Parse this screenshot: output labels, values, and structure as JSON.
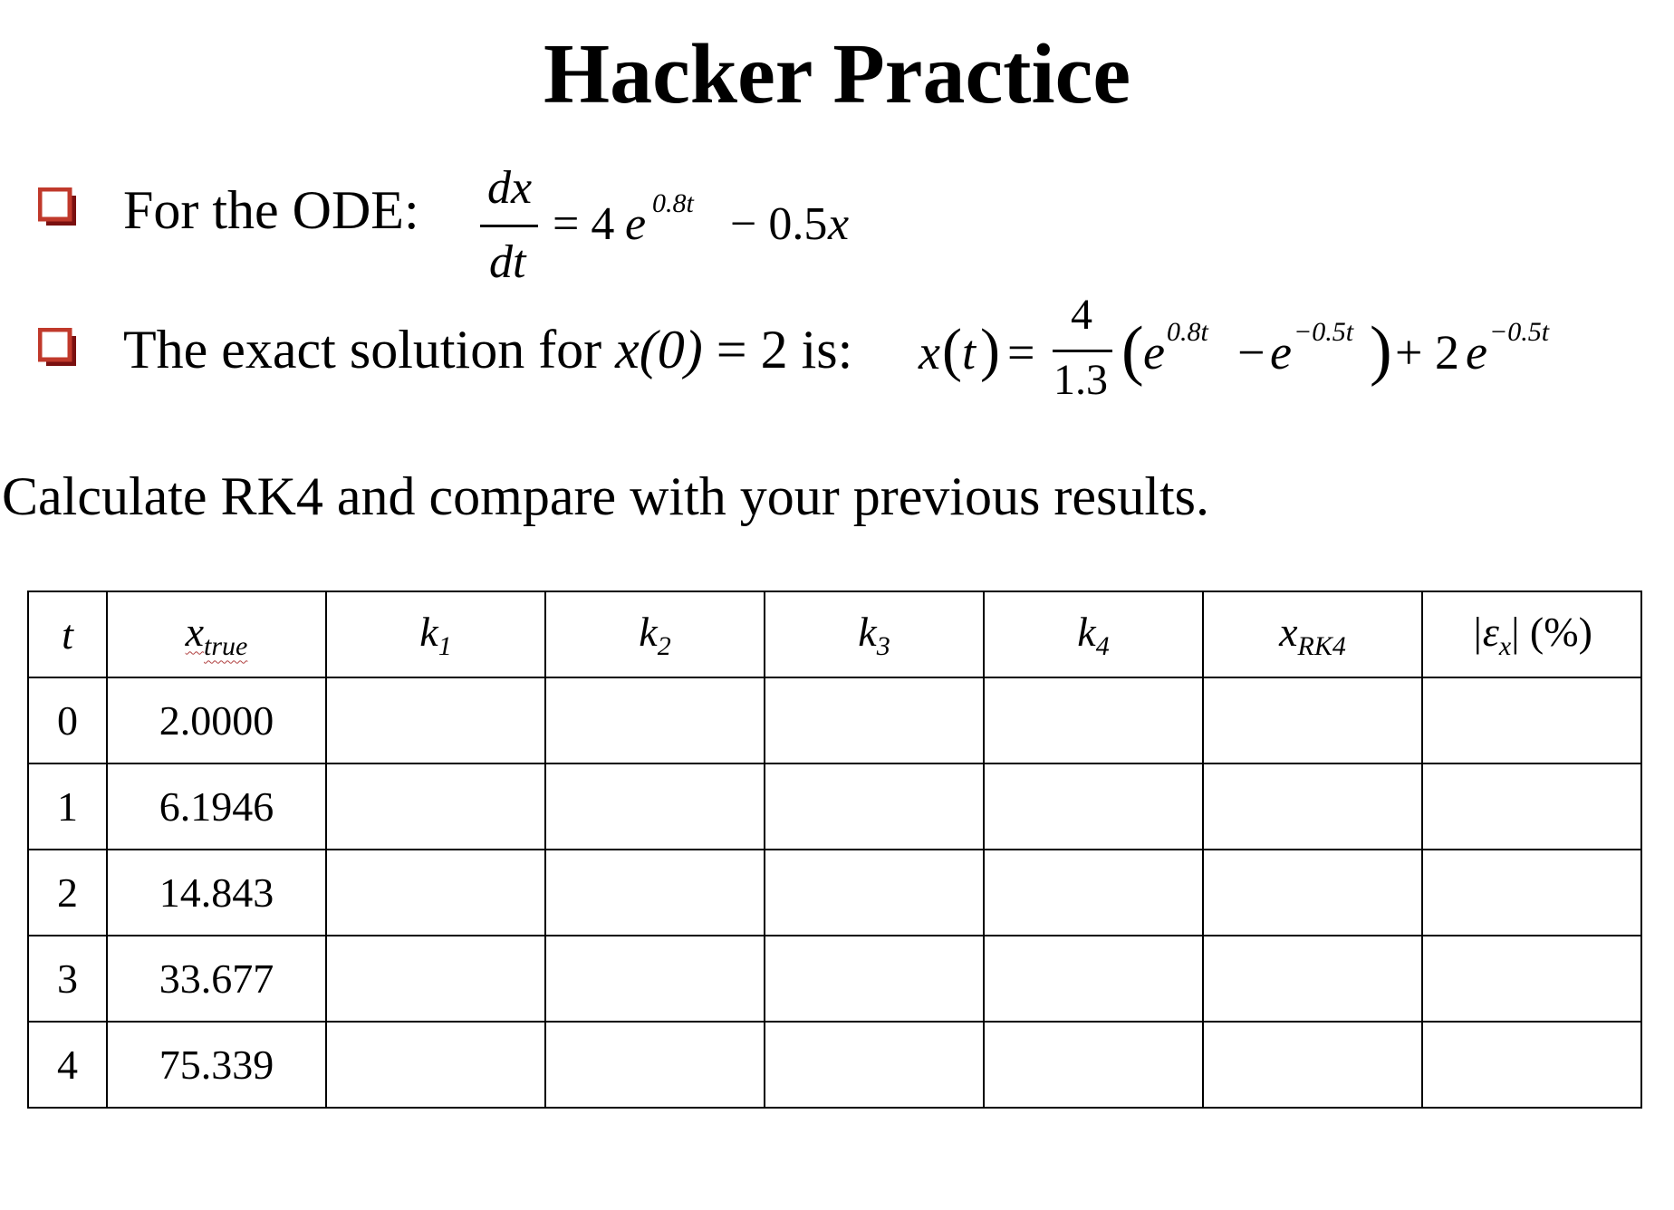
{
  "title": "Hacker Practice",
  "bullets": {
    "ode_label": "For the ODE:",
    "exact_label": "The exact solution for",
    "condition": "x(0)",
    "condition_rest": " = 2 is:"
  },
  "ode": {
    "num": "dx",
    "den": "dt",
    "rhs_eq": "= 4",
    "rhs_e": "e",
    "rhs_exp": "0.8t",
    "rhs_minus": "− 0.5",
    "rhs_x": "x"
  },
  "exact": {
    "lhs": "x",
    "lhs_t": "t",
    "eq": "=",
    "num": "4",
    "den": "1.3",
    "e1": "e",
    "e1_exp": "0.8t",
    "minus": "−",
    "e2": "e",
    "e2_exp": "−0.5t",
    "plus": "+ 2",
    "e3": "e",
    "e3_exp": "−0.5t"
  },
  "instruction": "Calculate RK4 and compare with your previous results.",
  "table": {
    "headers": [
      {
        "main": "t",
        "sub": ""
      },
      {
        "main": "x",
        "sub": "true"
      },
      {
        "main": "k",
        "sub": "1"
      },
      {
        "main": "k",
        "sub": "2"
      },
      {
        "main": "k",
        "sub": "3"
      },
      {
        "main": "k",
        "sub": "4"
      },
      {
        "main": "x",
        "sub": "RK4"
      },
      {
        "main": "|ε",
        "sub": "x",
        "suffix": "| (%)"
      }
    ],
    "rows": [
      {
        "t": "0",
        "x_true": "2.0000"
      },
      {
        "t": "1",
        "x_true": "6.1946"
      },
      {
        "t": "2",
        "x_true": "14.843"
      },
      {
        "t": "3",
        "x_true": "33.677"
      },
      {
        "t": "4",
        "x_true": "75.339"
      }
    ]
  },
  "colors": {
    "bullet": "#c0392b",
    "text": "#000000"
  }
}
